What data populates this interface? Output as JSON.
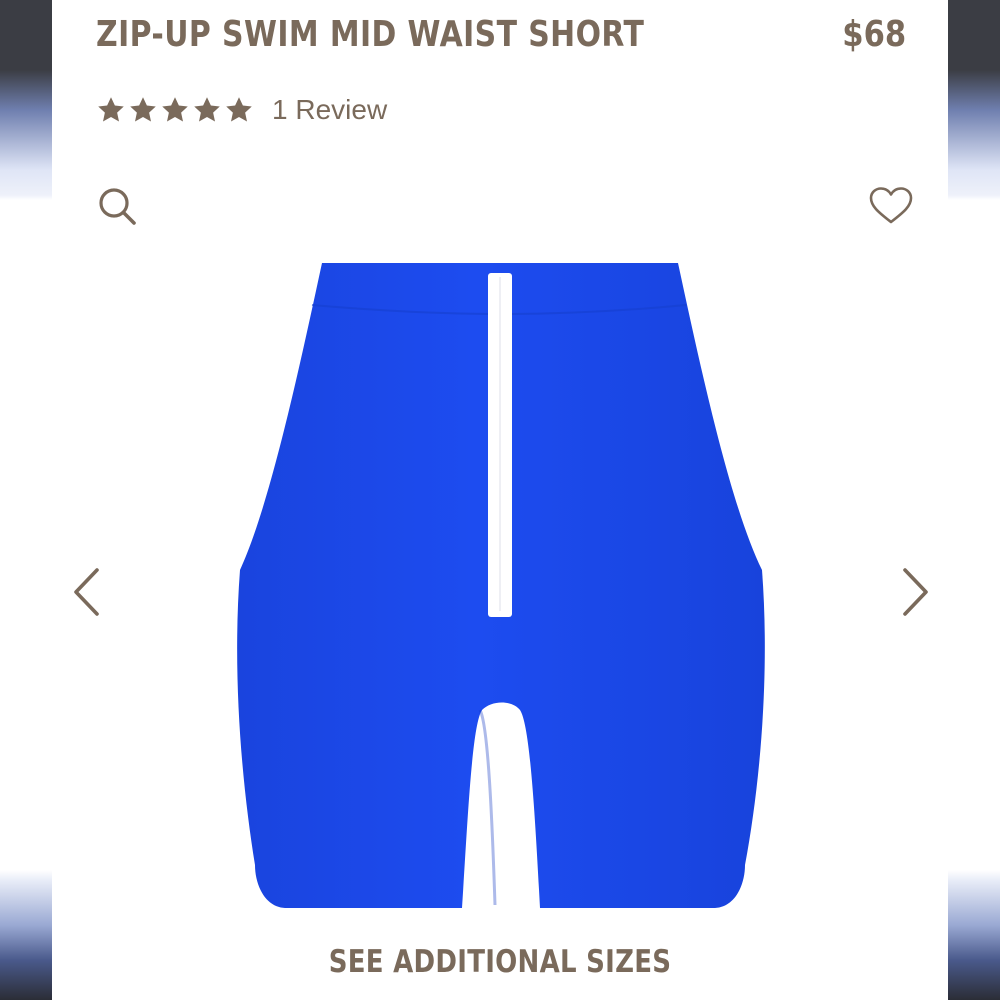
{
  "product": {
    "title": "ZIP-UP SWIM MID WAIST SHORT",
    "price": "$68"
  },
  "rating": {
    "stars": 5,
    "max_stars": 5,
    "review_label": "1 Review"
  },
  "icons": {
    "search": "search-icon",
    "wishlist": "heart-icon",
    "previous": "chevron-left-icon",
    "next": "chevron-right-icon",
    "star": "star-icon"
  },
  "gallery": {
    "product_image": "blue zip-up swim shorts"
  },
  "actions": {
    "see_sizes_label": "SEE ADDITIONAL SIZES"
  },
  "colors": {
    "brand_text": "#7a6a5b",
    "product_blue": "#1a47e6",
    "zipper": "#ffffff"
  }
}
